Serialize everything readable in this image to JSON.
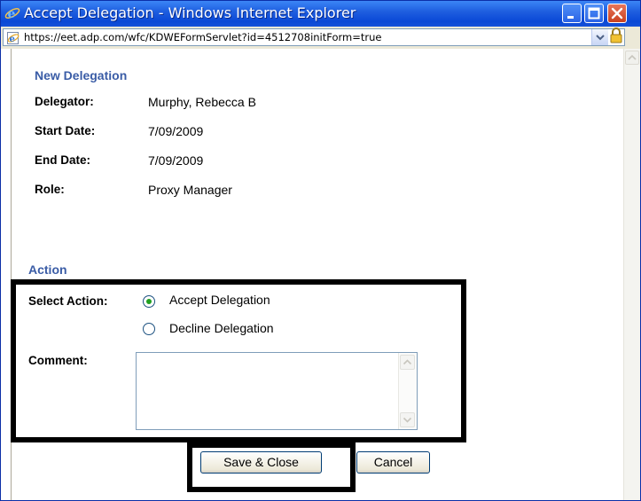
{
  "window": {
    "title": "Accept Delegation - Windows Internet Explorer",
    "url": "https://eet.adp.com/wfc/KDWEFormServlet?id=4512708initForm=true"
  },
  "delegation": {
    "section_title": "New Delegation",
    "fields": [
      {
        "label": "Delegator:",
        "value": "Murphy, Rebecca B"
      },
      {
        "label": "Start Date:",
        "value": "7/09/2009"
      },
      {
        "label": "End Date:",
        "value": "7/09/2009"
      },
      {
        "label": "Role:",
        "value": "Proxy Manager"
      }
    ]
  },
  "action": {
    "section_title": "Action",
    "select_label": "Select Action:",
    "options": [
      {
        "label": "Accept Delegation",
        "selected": true
      },
      {
        "label": "Decline Delegation",
        "selected": false
      }
    ],
    "comment_label": "Comment:",
    "comment_value": ""
  },
  "buttons": {
    "save_label": "Save & Close",
    "cancel_label": "Cancel"
  },
  "colors": {
    "title_bar": "#0a48d6",
    "section_title": "#3a5ca6",
    "radio_selected": "#21a121",
    "highlight_border": "#000000"
  },
  "icons": {
    "browser_icon": "ie-icon",
    "lock_icon": "lock-icon"
  }
}
